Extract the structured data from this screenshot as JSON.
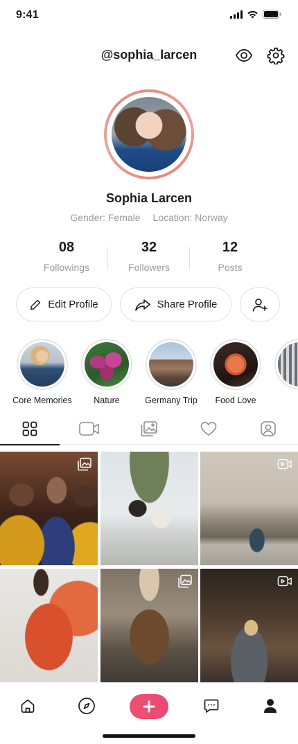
{
  "status": {
    "time": "9:41"
  },
  "header": {
    "username": "@sophia_larcen",
    "icons": [
      "eye-icon",
      "gear-icon"
    ]
  },
  "profile": {
    "name": "Sophia Larcen",
    "gender": "Gender: Female",
    "location": "Location: Norway"
  },
  "stats": [
    {
      "value": "08",
      "label": "Followings"
    },
    {
      "value": "32",
      "label": "Followers"
    },
    {
      "value": "12",
      "label": "Posts"
    }
  ],
  "actions": {
    "edit_label": "Edit Profile",
    "share_label": "Share Profile",
    "add_friend_icon": "add-user-icon"
  },
  "highlights": [
    {
      "label": "Core Memories"
    },
    {
      "label": "Nature"
    },
    {
      "label": "Germany Trip"
    },
    {
      "label": "Food Love"
    },
    {
      "label": ""
    }
  ],
  "tabs": [
    "grid-icon",
    "video-icon",
    "gallery-icon",
    "heart-icon",
    "tagged-user-icon"
  ],
  "posts": [
    {
      "type": "gallery"
    },
    {
      "type": "photo"
    },
    {
      "type": "video"
    },
    {
      "type": "photo"
    },
    {
      "type": "gallery"
    },
    {
      "type": "video"
    }
  ],
  "bottom_nav": [
    "home-icon",
    "compass-icon",
    "plus-icon",
    "chat-icon",
    "profile-icon"
  ],
  "colors": {
    "accent": "#ee4e6f",
    "ring": "#e8867a",
    "muted_text": "#9a9aa0"
  }
}
